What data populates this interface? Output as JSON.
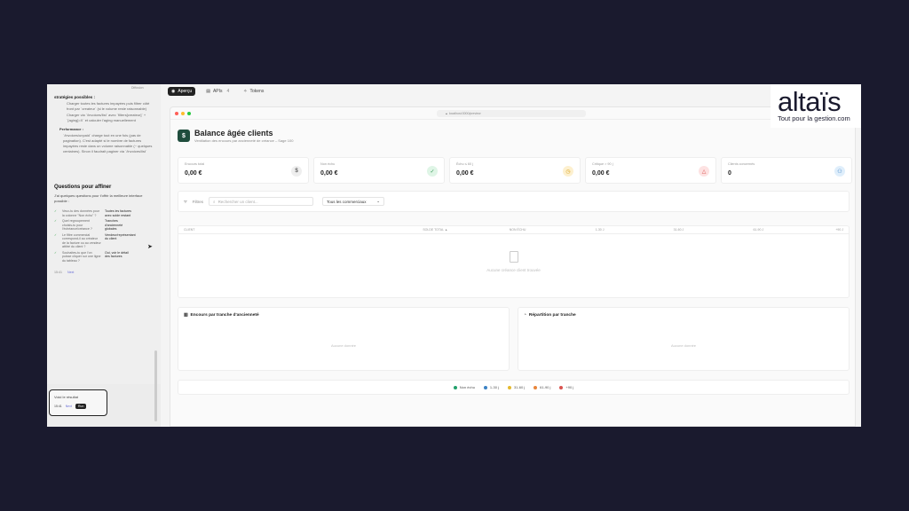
{
  "chat": {
    "top_label": "Diffusion",
    "section_title": "stratégies possibles :",
    "items": [
      "Charger toutes les factures impayées puis filtrer côté front par `createur` (si le volume reste raisonnable)",
      "Charger via `/invoices/list` avec `filters[createur]` + `[aging]=X` et calculer l'aging manuellement"
    ],
    "perf_title": "Performance :",
    "perf_text": "`/invoices/unpaid` charge tout en une fois (pas de pagination). C'est adapté si le nombre de factures impayées reste dans un volume raisonnable (~ quelques centaines). Sinon il faudrait paginer via `/invoices/list`",
    "questions_title": "Questions pour affiner",
    "questions_desc": "J'ai quelques questions pour t'offrir la meilleure interface possible :",
    "qa": [
      {
        "q": "Veux-tu des données pour la colonne \"Non échu\" ?",
        "a": "Toutes les factures avec solde restant"
      },
      {
        "q": "Quel regroupement choisis-tu pour l'échéance/créance ?",
        "a": "Tranches d'ancienneté globales"
      },
      {
        "q": "Le filtre commercial correspond-il au créateur de la facture ou au vendeur attitré du client ?",
        "a": "Vendeur/représentant du client"
      },
      {
        "q": "Souhaites-tu que l'on puisse cliquer sur une ligne du tableau ?",
        "a": "Oui, voir le détail des factures"
      }
    ],
    "meta_time": "15:41",
    "meta_pill": "Next",
    "result_text": "Voici le résultat",
    "result_time": "15:41",
    "result_pill": "Next",
    "result_dark": "Run"
  },
  "tabs": [
    {
      "label": "Aperçu",
      "count": ""
    },
    {
      "label": "APIs",
      "count": "4"
    },
    {
      "label": "Tokens",
      "count": ""
    }
  ],
  "browser": {
    "url": "localhost:3000/preview"
  },
  "page": {
    "icon": "$",
    "title": "Balance âgée clients",
    "subtitle": "Ventilation des encours par ancienneté de créance – Sage 100"
  },
  "cards": [
    {
      "label": "Encours total",
      "value": "0,00 €",
      "icon": "$",
      "color": "#eee",
      "fg": "#333"
    },
    {
      "label": "Non échu",
      "value": "0,00 €",
      "icon": "✓",
      "color": "#dff5e6",
      "fg": "#3a9a5a"
    },
    {
      "label": "Échu ≤ 60 j",
      "value": "0,00 €",
      "icon": "◷",
      "color": "#fdf0cf",
      "fg": "#d9a21a"
    },
    {
      "label": "Critique > 90 j",
      "value": "0,00 €",
      "icon": "△",
      "color": "#fde2e2",
      "fg": "#d9534f"
    },
    {
      "label": "Clients concernés",
      "value": "0",
      "icon": "⚇",
      "color": "#dfeefb",
      "fg": "#3b82c4"
    }
  ],
  "filters": {
    "label": "Filtres",
    "search_placeholder": "Rechercher un client...",
    "select_value": "Tous les commerciaux"
  },
  "table": {
    "headers": [
      "CLIENT",
      "SOLDE TOTAL ▲",
      "NON ÉCHU",
      "1-30 J",
      "31-60 J",
      "61-90 J",
      "+90 J"
    ],
    "empty": "Aucune créance client trouvée"
  },
  "panels": [
    {
      "title": "Encours par tranche d'ancienneté",
      "empty": "Aucune donnée"
    },
    {
      "title": "Répartition par tranche",
      "empty": "Aucune donnée"
    }
  ],
  "legend": [
    {
      "label": "Non échu",
      "color": "#22a06b"
    },
    {
      "label": "1-30 j",
      "color": "#3b82c4"
    },
    {
      "label": "31-60 j",
      "color": "#e5b92e"
    },
    {
      "label": "61-90 j",
      "color": "#e8853a"
    },
    {
      "label": "+90 j",
      "color": "#d9534f"
    }
  ],
  "logo": {
    "word": "altaïs",
    "tagline": "Tout pour la gestion.com"
  }
}
